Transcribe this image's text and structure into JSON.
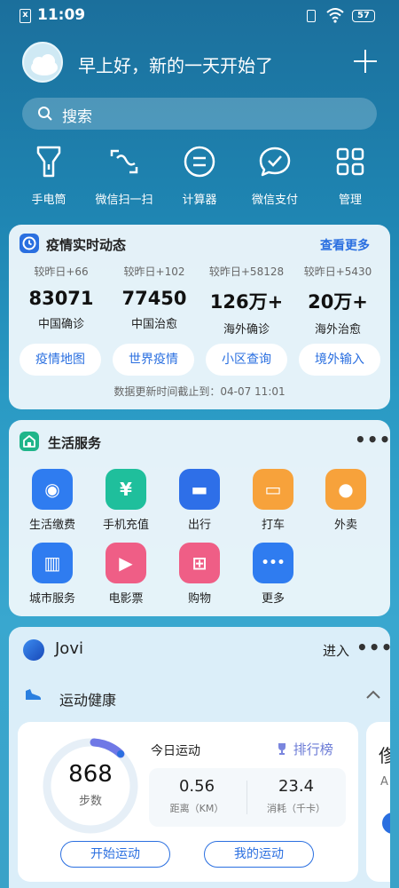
{
  "status_bar": {
    "time": "11:09",
    "battery": "57",
    "sim_glyph": "x"
  },
  "header": {
    "greeting": "早上好，新的一天开始了"
  },
  "search": {
    "placeholder": "搜索"
  },
  "quick_tools": [
    {
      "label": "手电筒",
      "icon": "flashlight-icon"
    },
    {
      "label": "微信扫一扫",
      "icon": "scan-icon"
    },
    {
      "label": "计算器",
      "icon": "calculator-icon"
    },
    {
      "label": "微信支付",
      "icon": "wechat-pay-icon"
    },
    {
      "label": "管理",
      "icon": "grid-icon"
    }
  ],
  "epidemic": {
    "title": "疫情实时动态",
    "more": "查看更多",
    "stats": [
      {
        "delta": "较昨日+66",
        "value": "83071",
        "label": "中国确诊"
      },
      {
        "delta": "较昨日+102",
        "value": "77450",
        "label": "中国治愈"
      },
      {
        "delta": "较昨日+58128",
        "value": "126万+",
        "label": "海外确诊"
      },
      {
        "delta": "较昨日+5430",
        "value": "20万+",
        "label": "海外治愈"
      }
    ],
    "buttons": [
      "疫情地图",
      "世界疫情",
      "小区查询",
      "境外输入"
    ],
    "updated": "数据更新时间截止到：04-07 11:01"
  },
  "life_services": {
    "title": "生活服务",
    "items": [
      {
        "label": "生活缴费",
        "icon": "utility-icon",
        "color": "#2f7cf0",
        "glyph": "◉"
      },
      {
        "label": "手机充值",
        "icon": "phone-recharge-icon",
        "color": "#1fbf9c",
        "glyph": "¥"
      },
      {
        "label": "出行",
        "icon": "train-icon",
        "color": "#2e6fe8",
        "glyph": "▬"
      },
      {
        "label": "打车",
        "icon": "car-icon",
        "color": "#f7a23b",
        "glyph": "▭"
      },
      {
        "label": "外卖",
        "icon": "scooter-icon",
        "color": "#f7a23b",
        "glyph": "●"
      },
      {
        "label": "城市服务",
        "icon": "city-icon",
        "color": "#2f7cf0",
        "glyph": "▥"
      },
      {
        "label": "电影票",
        "icon": "ticket-icon",
        "color": "#ef5e86",
        "glyph": "▶"
      },
      {
        "label": "购物",
        "icon": "cart-icon",
        "color": "#ef5e86",
        "glyph": "⊞"
      },
      {
        "label": "更多",
        "icon": "more-icon",
        "color": "#2f7cf0",
        "glyph": "•••"
      }
    ]
  },
  "jovi": {
    "name": "Jovi",
    "enter": "进入",
    "health": {
      "title": "运动健康",
      "steps": "868",
      "steps_label": "步数",
      "today": "今日运动",
      "rank": "排行榜",
      "distance": {
        "value": "0.56",
        "label": "距离（KM）"
      },
      "calories": {
        "value": "23.4",
        "label": "消耗（千卡）"
      },
      "start": "开始运动",
      "mine": "我的运动",
      "peek_glyph": "俢",
      "peek_letter": "A"
    }
  },
  "colors": {
    "accent": "#2a6fe0",
    "card_bg": "#ecf6fb"
  }
}
